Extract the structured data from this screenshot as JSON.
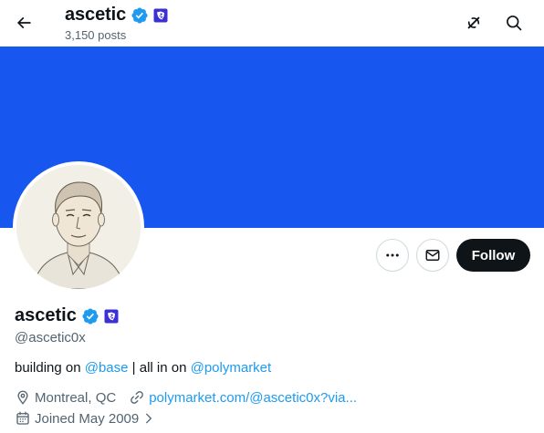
{
  "header": {
    "title": "ascetic",
    "posts_count": "3,150 posts"
  },
  "colors": {
    "banner": "#1757f0",
    "verified": "#1d9bf0",
    "affiliate_badge": "#3b2fd6",
    "link": "#1d9bf0",
    "follow_bg": "#0f1419"
  },
  "icons": {
    "back": "arrow-left-icon",
    "grok": "grok-icon",
    "search": "search-icon",
    "more": "more-dots-icon",
    "message": "envelope-icon",
    "location": "location-pin-icon",
    "website": "link-icon",
    "joined": "calendar-icon",
    "chevron": "chevron-right-icon"
  },
  "profile": {
    "display_name": "ascetic",
    "handle": "@ascetic0x",
    "bio": {
      "prefix": "building on ",
      "mention1": "@base",
      "middle": " | all in on ",
      "mention2": "@polymarket"
    },
    "location": "Montreal, QC",
    "website": "polymarket.com/@ascetic0x?via...",
    "joined": "Joined May 2009"
  },
  "actions": {
    "follow_label": "Follow"
  }
}
